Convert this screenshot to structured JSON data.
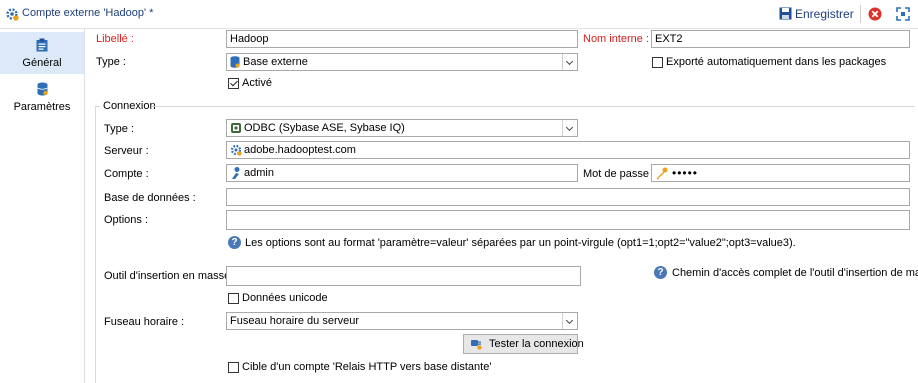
{
  "window": {
    "title": "Compte externe 'Hadoop' *",
    "save_label": "Enregistrer"
  },
  "sidebar": {
    "items": [
      {
        "label": "Général",
        "icon": "clipboard-icon",
        "active": true
      },
      {
        "label": "Paramètres",
        "icon": "database-icon",
        "active": false
      }
    ]
  },
  "form": {
    "libelle_label": "Libellé :",
    "libelle_value": "Hadoop",
    "nom_interne_label": "Nom interne :",
    "nom_interne_value": "EXT2",
    "type_label": "Type :",
    "type_value": "Base externe",
    "export_auto_label": "Exporté automatiquement dans les packages",
    "export_auto_checked": false,
    "active_label": "Activé",
    "active_checked": true
  },
  "connexion": {
    "group_label": "Connexion",
    "type_label": "Type :",
    "type_value": "ODBC (Sybase ASE, Sybase IQ)",
    "serveur_label": "Serveur :",
    "serveur_value": "adobe.hadooptest.com",
    "compte_label": "Compte :",
    "compte_value": "admin",
    "mot_de_passe_label": "Mot de passe :",
    "mot_de_passe_value": "•••••",
    "base_label": "Base de données :",
    "base_value": "",
    "options_label": "Options :",
    "options_value": "",
    "options_hint": "Les options sont au format 'paramètre=valeur' séparées par un point-virgule (opt1=1;opt2=\"value2\";opt3=value3).",
    "outil_label": "Outil d'insertion en masse :",
    "outil_value": "",
    "outil_hint": "Chemin d'accès complet de l'outil d'insertion de masse",
    "unicode_label": "Données unicode",
    "unicode_checked": false,
    "fuseau_label": "Fuseau horaire :",
    "fuseau_value": "Fuseau horaire du serveur",
    "test_button": "Tester la connexion",
    "relais_label": "Cible d'un compte 'Relais HTTP vers base distante'",
    "relais_checked": false
  },
  "colors": {
    "title_text": "#1e3f78",
    "required_label": "#d61f1f",
    "nav_active_bg": "#dce9f8",
    "info_icon": "#4a78b8"
  }
}
